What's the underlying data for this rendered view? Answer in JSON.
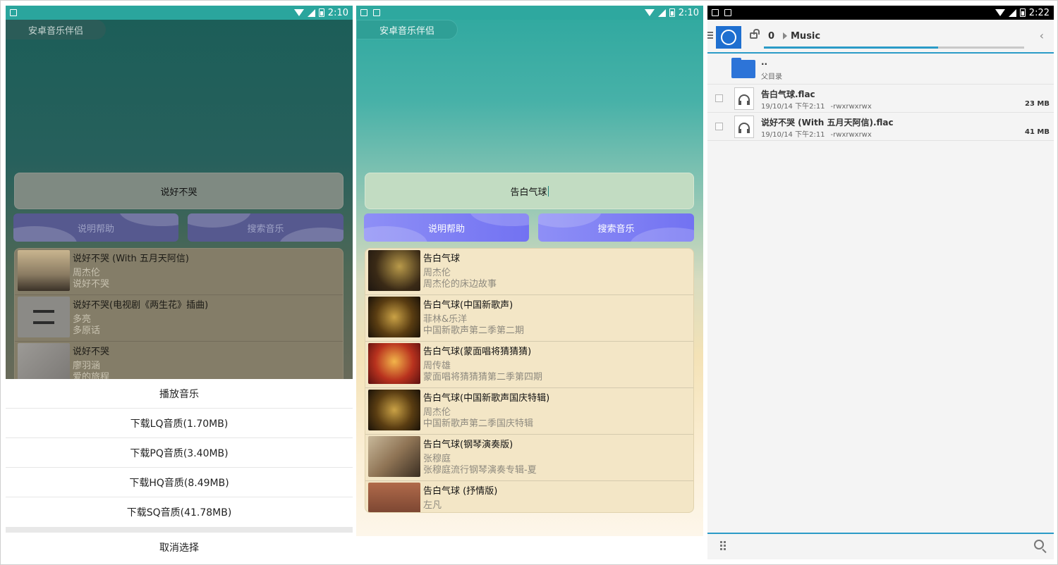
{
  "screen1": {
    "status_time": "2:10",
    "app_title": "安卓音乐伴侣",
    "search_value": "说好不哭",
    "help_button": "说明帮助",
    "search_button": "搜索音乐",
    "results": [
      {
        "title": "说好不哭 (With 五月天阿信)",
        "artist": "周杰伦",
        "album": "说好不哭"
      },
      {
        "title": "说好不哭(电视剧《两生花》插曲)",
        "artist": "多亮",
        "album": "多原话"
      },
      {
        "title": "说好不哭",
        "artist": "廖羽涵",
        "album": "爱的旅程"
      }
    ],
    "sheet": {
      "items": [
        "播放音乐",
        "下载LQ音质(1.70MB)",
        "下载PQ音质(3.40MB)",
        "下载HQ音质(8.49MB)",
        "下载SQ音质(41.78MB)"
      ],
      "cancel": "取消选择"
    }
  },
  "screen2": {
    "status_time": "2:10",
    "app_title": "安卓音乐伴侣",
    "search_value": "告白气球",
    "help_button": "说明帮助",
    "search_button": "搜索音乐",
    "results": [
      {
        "title": "告白气球",
        "artist": "周杰伦",
        "album": "周杰伦的床边故事"
      },
      {
        "title": "告白气球(中国新歌声)",
        "artist": "菲林&乐洋",
        "album": "中国新歌声第二季第二期"
      },
      {
        "title": "告白气球(蒙面唱将猜猜猜)",
        "artist": "周传雄",
        "album": "蒙面唱将猜猜猜第二季第四期"
      },
      {
        "title": "告白气球(中国新歌声国庆特辑)",
        "artist": "周杰伦",
        "album": "中国新歌声第二季国庆特辑"
      },
      {
        "title": "告白气球(钢琴演奏版)",
        "artist": "张穆庭",
        "album": "张穆庭流行钢琴演奏专辑-夏"
      },
      {
        "title": "告白气球 (抒情版)",
        "artist": "左凡",
        "album": ""
      }
    ]
  },
  "screen3": {
    "status_time": "2:22",
    "crumb_count": "0",
    "crumb_name": "Music",
    "parent": {
      "name": "..",
      "label": "父目录"
    },
    "files": [
      {
        "name": "告白气球.flac",
        "date": "19/10/14 下午2:11",
        "perm": "-rwxrwxrwx",
        "size": "23 MB"
      },
      {
        "name": "说好不哭 (With 五月天阿信).flac",
        "date": "19/10/14 下午2:11",
        "perm": "-rwxrwxrwx",
        "size": "41 MB"
      }
    ],
    "progress": 0.67
  },
  "colors": {
    "teal": "#2ea89f",
    "accent_blue": "#2b9bc7",
    "button_purple": "#7f7ff4",
    "folder_blue": "#2d74d8"
  },
  "icons": [
    "wifi-icon",
    "signal-icon",
    "battery-icon",
    "menu-icon",
    "lock-icon",
    "folder-icon",
    "audio-file-icon",
    "back-icon",
    "grip-icon",
    "search-icon"
  ]
}
